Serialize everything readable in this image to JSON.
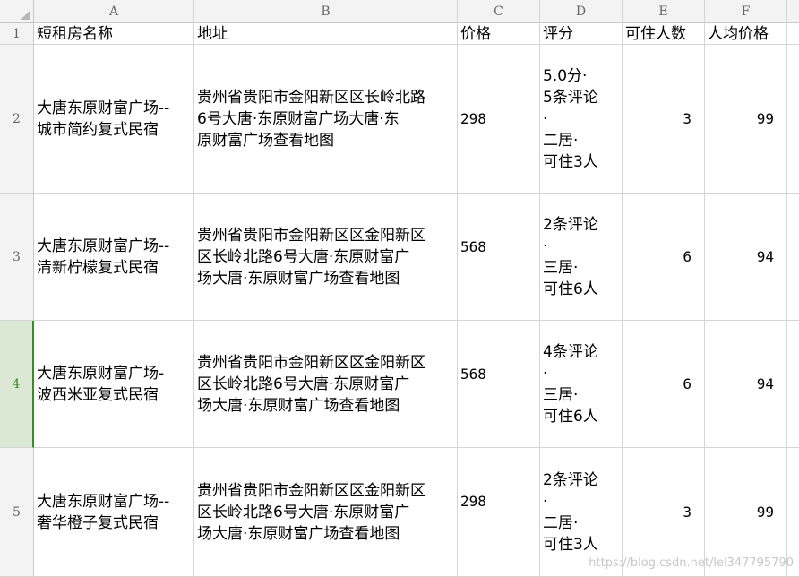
{
  "columns": [
    "A",
    "B",
    "C",
    "D",
    "E",
    "F"
  ],
  "rows": [
    "1",
    "2",
    "3",
    "4",
    "5"
  ],
  "selected_row": "4",
  "header_row": [
    "短租房名称",
    "地址",
    "价格",
    "评分",
    "可住人数",
    "人均价格"
  ],
  "data_rows": [
    {
      "name": "大唐东原财富广场--\n城市简约复式民宿",
      "address": "贵州省贵阳市金阳新区区长岭北路\n6号大唐·东原财富广场大唐·东\n原财富广场查看地图",
      "price": "298",
      "rating": "5.0分·\n5条评论\n·\n二居·\n可住3人",
      "capacity": "3",
      "per_person": "99"
    },
    {
      "name": "大唐东原财富广场--\n清新柠檬复式民宿",
      "address": "贵州省贵阳市金阳新区区金阳新区\n区长岭北路6号大唐·东原财富广\n场大唐·东原财富广场查看地图",
      "price": "568",
      "rating": "2条评论\n·\n三居·\n可住6人",
      "capacity": "6",
      "per_person": "94"
    },
    {
      "name": "大唐东原财富广场-\n波西米亚复式民宿",
      "address": "贵州省贵阳市金阳新区区金阳新区\n区长岭北路6号大唐·东原财富广\n场大唐·东原财富广场查看地图",
      "price": "568",
      "rating": "4条评论\n·\n三居·\n可住6人",
      "capacity": "6",
      "per_person": "94"
    },
    {
      "name": "大唐东原财富广场--\n奢华橙子复式民宿",
      "address": "贵州省贵阳市金阳新区区金阳新区\n区长岭北路6号大唐·东原财富广\n场大唐·东原财富广场查看地图",
      "price": "298",
      "rating": "2条评论\n·\n二居·\n可住3人",
      "capacity": "3",
      "per_person": "99"
    }
  ],
  "watermark": "https://blog.csdn.net/lei347795790",
  "colors": {
    "header_bg": "#f3f3f3",
    "selected_row_bg": "#dbe9d4",
    "selected_accent": "#3b8a2a",
    "gridline": "#d4d4d4"
  }
}
